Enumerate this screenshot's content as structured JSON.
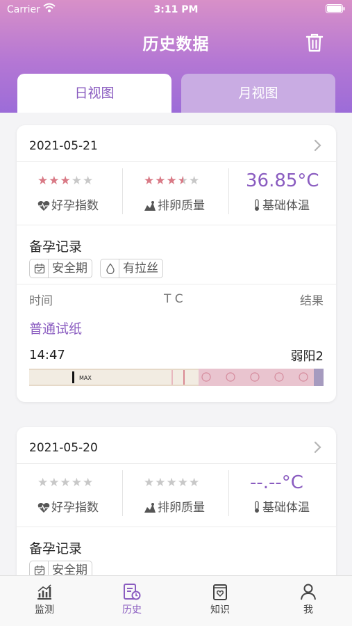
{
  "status_bar": {
    "carrier": "Carrier",
    "time": "3:11 PM"
  },
  "header": {
    "title": "历史数据"
  },
  "tabs": [
    {
      "label": "日视图",
      "active": true
    },
    {
      "label": "月视图",
      "active": false
    }
  ],
  "colors": {
    "accent": "#8a5cc0",
    "star_filled": "#d97a86",
    "star_empty": "#c8c8c8"
  },
  "cards": [
    {
      "date": "2021-05-21",
      "stats": {
        "pregnancy_index": {
          "stars": "★★★★★",
          "rating": 3,
          "label": "好孕指数"
        },
        "ovulation_quality": {
          "stars": "★★★★★",
          "rating": 3.5,
          "label": "排卵质量"
        },
        "basal_temp": {
          "value": "36.85°C",
          "label": "基础体温"
        }
      },
      "record_title": "备孕记录",
      "tags": [
        {
          "label": "安全期",
          "icon": "calendar-icon"
        },
        {
          "label": "有拉丝",
          "icon": "drop-icon"
        }
      ],
      "columns": {
        "time": "时间",
        "tc": "T C",
        "result": "结果"
      },
      "test": {
        "type": "普通试纸",
        "time": "14:47",
        "result": "弱阳2",
        "strip_label": "MAX"
      }
    },
    {
      "date": "2021-05-20",
      "stats": {
        "pregnancy_index": {
          "stars": "★★★★★",
          "rating": 0,
          "label": "好孕指数"
        },
        "ovulation_quality": {
          "stars": "★★★★★",
          "rating": 0,
          "label": "排卵质量"
        },
        "basal_temp": {
          "value": "--.--°C",
          "label": "基础体温"
        }
      },
      "record_title": "备孕记录",
      "tags": [
        {
          "label": "安全期",
          "icon": "calendar-icon"
        }
      ]
    }
  ],
  "tabbar": [
    {
      "label": "监测",
      "icon": "chart-icon",
      "active": false
    },
    {
      "label": "历史",
      "icon": "history-icon",
      "active": true
    },
    {
      "label": "知识",
      "icon": "book-icon",
      "active": false
    },
    {
      "label": "我",
      "icon": "profile-icon",
      "active": false
    }
  ]
}
